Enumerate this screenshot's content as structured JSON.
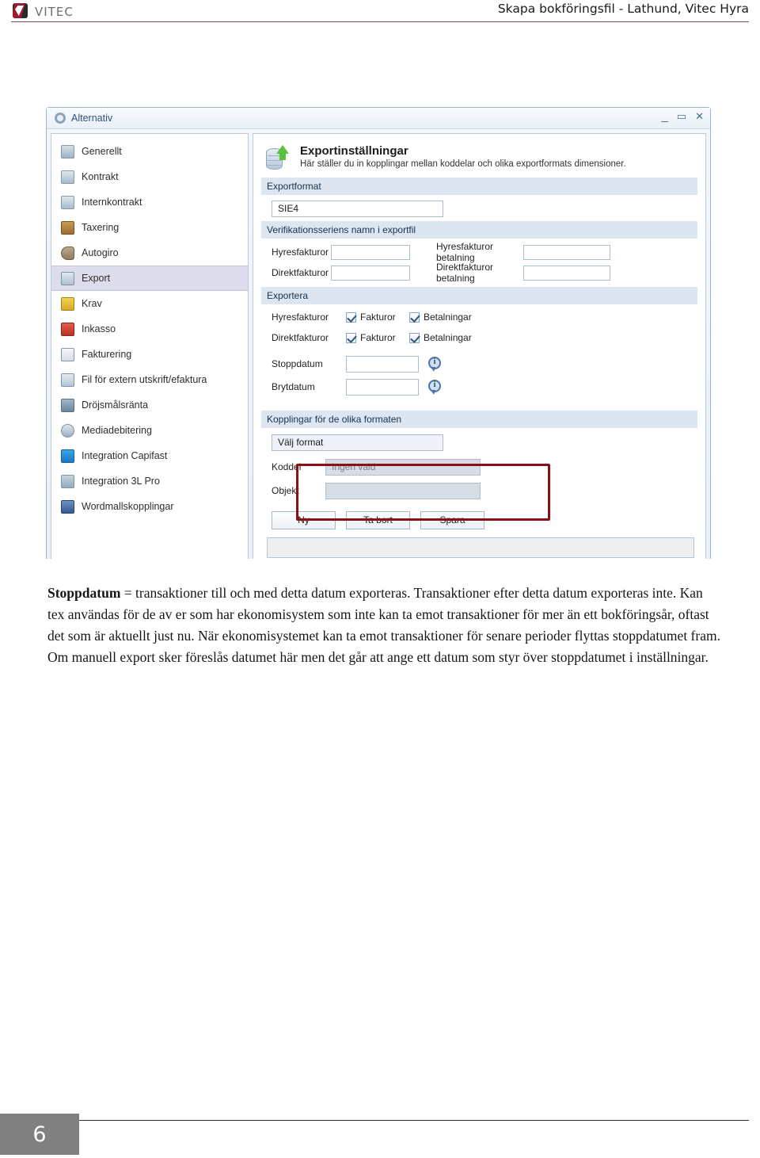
{
  "header": {
    "logo_text": "VITEC",
    "document_title": "Skapa bokföringsfil - Lathund, Vitec Hyra"
  },
  "dialog": {
    "title": "Alternativ",
    "title_icon": "gear-icon",
    "window_controls": {
      "minimize": "_",
      "maximize": "▭",
      "close": "✕"
    },
    "sidebar": {
      "items": [
        {
          "label": "Generellt",
          "icon": "generellt-icon",
          "selected": false
        },
        {
          "label": "Kontrakt",
          "icon": "kontrakt-icon",
          "selected": false
        },
        {
          "label": "Internkontrakt",
          "icon": "internkontrakt-icon",
          "selected": false
        },
        {
          "label": "Taxering",
          "icon": "taxering-icon",
          "selected": false
        },
        {
          "label": "Autogiro",
          "icon": "autogiro-icon",
          "selected": false
        },
        {
          "label": "Export",
          "icon": "export-icon",
          "selected": true
        },
        {
          "label": "Krav",
          "icon": "krav-icon",
          "selected": false
        },
        {
          "label": "Inkasso",
          "icon": "inkasso-icon",
          "selected": false
        },
        {
          "label": "Fakturering",
          "icon": "fakturering-icon",
          "selected": false
        },
        {
          "label": "Fil för extern utskrift/efaktura",
          "icon": "fil-extern-icon",
          "selected": false
        },
        {
          "label": "Dröjsmålsränta",
          "icon": "drojsmalsranta-icon",
          "selected": false
        },
        {
          "label": "Mediadebitering",
          "icon": "mediadebitering-icon",
          "selected": false
        },
        {
          "label": "Integration Capifast",
          "icon": "capifast-icon",
          "selected": false
        },
        {
          "label": "Integration 3L Pro",
          "icon": "3lpro-icon",
          "selected": false
        },
        {
          "label": "Wordmallskopplingar",
          "icon": "wordmall-icon",
          "selected": false
        }
      ]
    },
    "pane": {
      "heading": "Exportinställningar",
      "subheading": "Här ställer du in kopplingar mellan koddelar och olika exportformats dimensioner.",
      "heading_icon": "database-upload-icon",
      "sections": {
        "exportformat": {
          "header": "Exportformat",
          "format_value": "SIE4"
        },
        "verifikation": {
          "header": "Verifikationsseriens namn i exportfil",
          "fields": [
            {
              "label": "Hyresfakturor",
              "value": ""
            },
            {
              "label": "Hyresfakturor betalning",
              "value": ""
            },
            {
              "label": "Direktfakturor",
              "value": ""
            },
            {
              "label": "Direktfakturor betalning",
              "value": ""
            }
          ]
        },
        "exportera": {
          "header": "Exportera",
          "rows": [
            {
              "label": "Hyresfakturor",
              "cb1": "Fakturor",
              "cb1_checked": true,
              "cb2": "Betalningar",
              "cb2_checked": true
            },
            {
              "label": "Direktfakturor",
              "cb1": "Fakturor",
              "cb1_checked": true,
              "cb2": "Betalningar",
              "cb2_checked": true
            }
          ],
          "date_rows": [
            {
              "label": "Stoppdatum",
              "value": "",
              "info": "info-icon"
            },
            {
              "label": "Brytdatum",
              "value": "",
              "info": "info-icon"
            }
          ]
        },
        "kopplingar": {
          "header": "Kopplingar för de olika formaten",
          "format_select_value": "Välj format",
          "koddel_label": "Koddel",
          "koddel_value": "Ingen vald",
          "objekt_label": "Objekt",
          "objekt_value": "",
          "buttons": [
            "Ny",
            "Ta bort",
            "Spara"
          ]
        }
      }
    },
    "callout_color": "#8b1016"
  },
  "body_text": {
    "term": "Stoppdatum",
    "paragraph": " = transaktioner till och med detta datum exporteras. Transaktioner efter detta datum exporteras inte. Kan tex användas för de av er som har ekonomisystem som inte kan ta emot transaktioner för mer än ett bokföringsår, oftast det som är aktuellt just nu. När ekonomisystemet kan ta emot transaktioner för senare perioder flyttas stoppdatumet fram. Om manuell export sker föreslås datumet här men det går att ange ett datum som styr över stoppdatumet i inställningar."
  },
  "footer": {
    "page_number": "6"
  }
}
